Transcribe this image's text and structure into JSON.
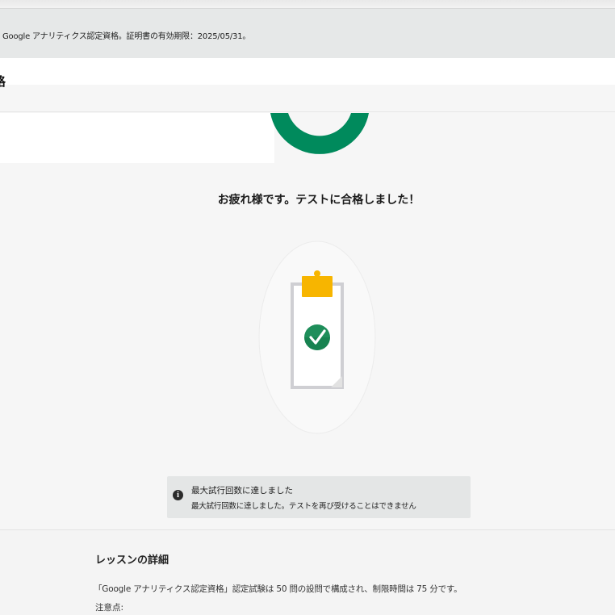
{
  "banner": {
    "notice": "Google アナリティクス認定資格。証明書の有効期限：2025/05/31。"
  },
  "course": {
    "title_partial": "格"
  },
  "result": {
    "heading": "お疲れ様です。テストに合格しました！"
  },
  "badge": {
    "icon": "clipboard-check-icon",
    "clip_color": "#f7b500",
    "check_color": "#1e8e5a"
  },
  "alert": {
    "icon": "info-icon",
    "title": "最大試行回数に達しました",
    "message": "最大試行回数に達しました。テストを再び受けることはできません"
  },
  "lesson_details": {
    "heading": "レッスンの詳細",
    "description": "「Google アナリティクス認定資格」認定試験は 50 問の設問で構成され、制限時間は 75 分です。",
    "notes_label": "注意点:"
  },
  "colors": {
    "progress_ring": "#008a5c",
    "background": "#f6f6f6"
  }
}
